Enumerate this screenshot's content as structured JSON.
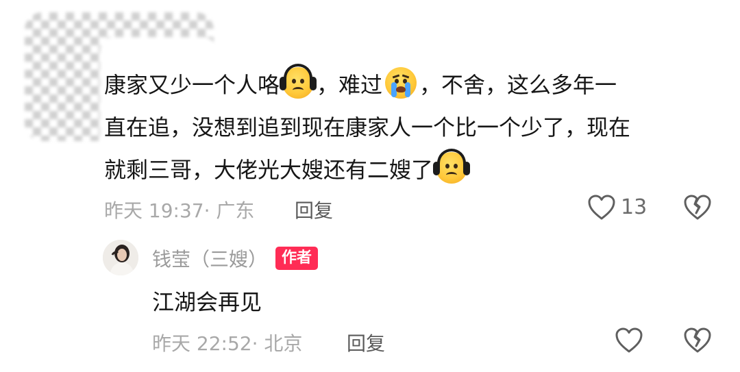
{
  "comment": {
    "lines": [
      [
        "康家又少一个人咯",
        "，难过",
        "，不舍，这么多年一"
      ],
      [
        "直在追，没想到追到现在康家人一个比一个少了，现在"
      ],
      [
        "就剩三哥，大佬光大嫂还有二嫂了"
      ]
    ],
    "emojis": [
      "headphones-sad-emoji",
      "crying-emoji",
      "headphones-sad-emoji"
    ],
    "meta": "昨天 19:37· 广东",
    "reply_label": "回复",
    "like_count": "13"
  },
  "reply": {
    "author": "钱莹（三嫂）",
    "badge": "作者",
    "text": "江湖会再见",
    "meta": "昨天 22:52· 北京",
    "reply_label": "回复"
  },
  "colors": {
    "badge": "#ff2c55",
    "meta_text": "#a8a8a8",
    "body_text": "#161616"
  }
}
